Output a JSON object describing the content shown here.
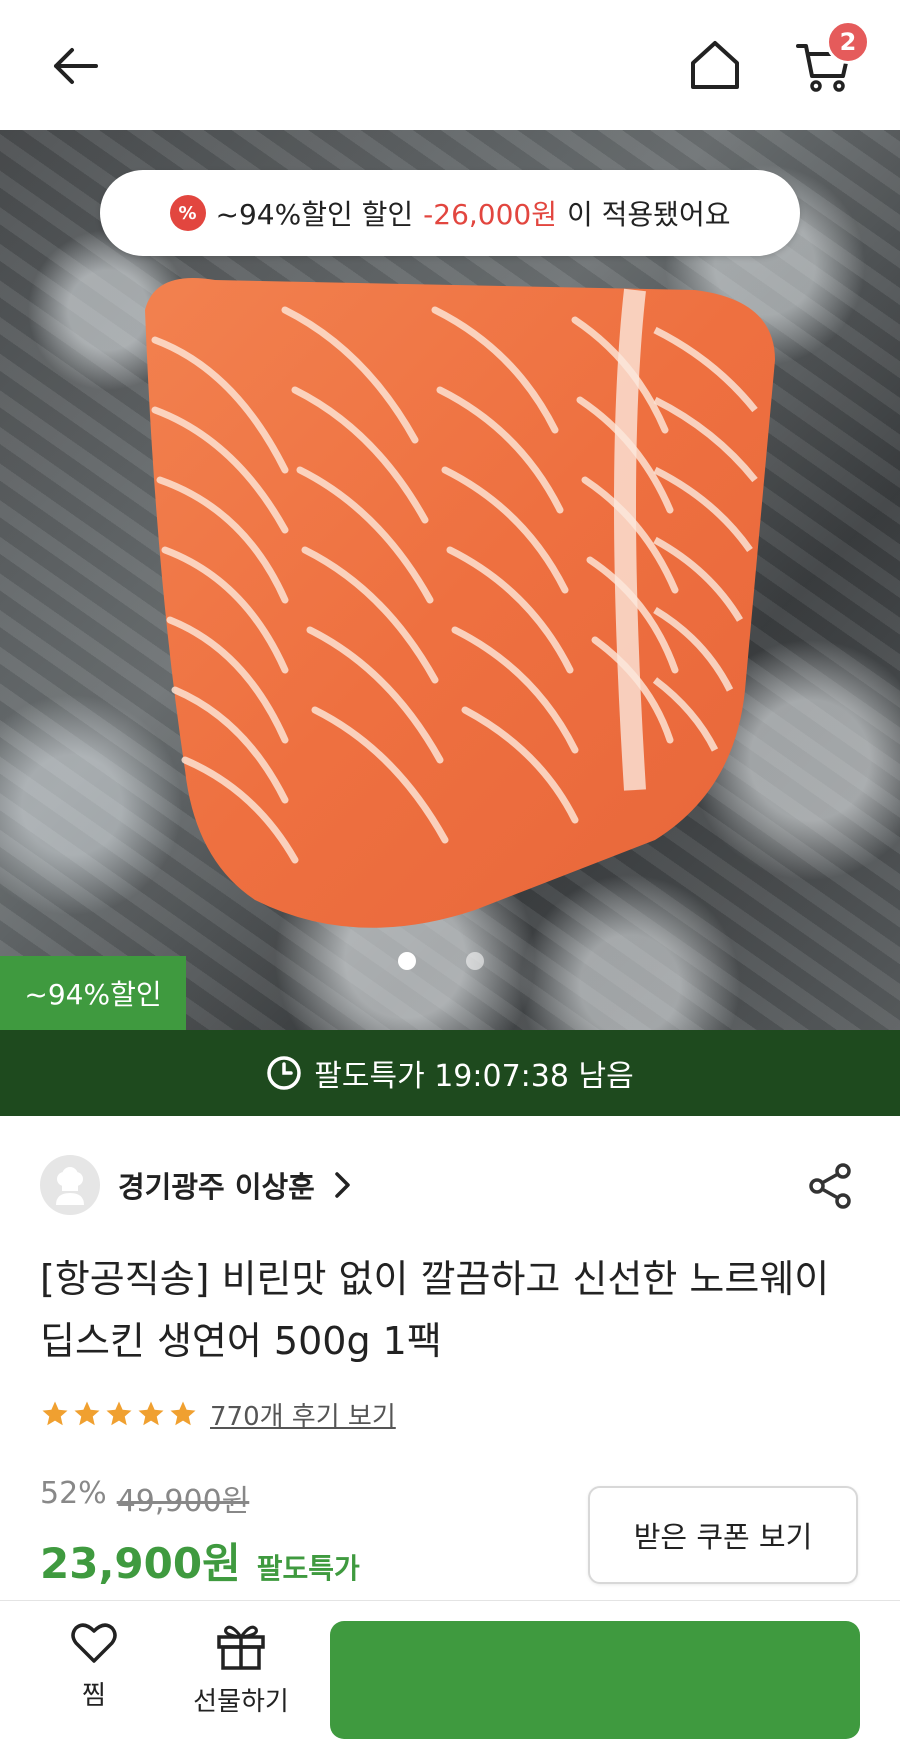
{
  "header": {
    "back_icon": "arrow-left-icon",
    "home_icon": "home-icon",
    "cart_icon": "cart-icon",
    "cart_count": "2"
  },
  "hero": {
    "discount_notice": {
      "icon": "percent-icon",
      "prefix": "~94%할인 할인",
      "amount": "-26,000원",
      "suffix": "이 적용됐어요",
      "amount_color": "#e2463f"
    },
    "corner_badge": "~94%할인",
    "slides": {
      "total": 2,
      "active": 1
    }
  },
  "timer": {
    "icon": "clock-icon",
    "text": "팔도특가 19:07:38 남음"
  },
  "seller": {
    "avatar_icon": "chef-avatar-icon",
    "name": "경기광주 이상훈",
    "chevron_icon": "chevron-right-icon",
    "share_icon": "share-icon"
  },
  "product": {
    "title": "[항공직송] 비린맛 없이 깔끔하고 신선한 노르웨이 딥스킨 생연어 500g 1팩",
    "rating": {
      "stars": 5,
      "max": 5,
      "review_link": "770개 후기 보기",
      "star_color": "#f0a030"
    },
    "price": {
      "discount_rate": "52%",
      "original": "49,900원",
      "sale": "23,900원",
      "sale_label": "팔도특가",
      "accent": "#3f9a3f"
    },
    "coupon_button": "받은 쿠폰 보기"
  },
  "bottom_bar": {
    "wish": {
      "icon": "heart-icon",
      "label": "찜"
    },
    "gift": {
      "icon": "gift-icon",
      "label": "선물하기"
    },
    "buy_button": "",
    "buy_color": "#3f9a3f"
  }
}
